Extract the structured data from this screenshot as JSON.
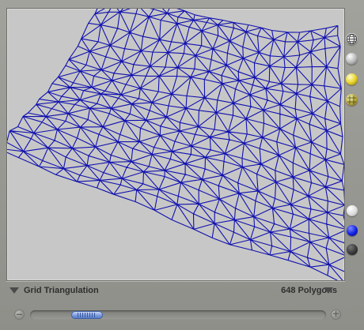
{
  "viewport": {
    "name": "wireframe-terrain",
    "wire_color": "#1010b0",
    "background_color": "#c7c7c7"
  },
  "render_mode_buttons": [
    "globe-icon",
    "silver-sphere-icon",
    "yellow-sphere-icon",
    "grid-sphere-icon"
  ],
  "color_swatches": [
    {
      "name": "white",
      "color": "#ffffff"
    },
    {
      "name": "blue",
      "color": "#1020e0"
    },
    {
      "name": "dark-gray",
      "color": "#3a3a3a"
    }
  ],
  "footer": {
    "mode_label": "Grid Triangulation",
    "polygon_label": "648 Polygons"
  },
  "slider": {
    "minus_glyph": "–",
    "plus_glyph": "+",
    "value_fraction": 0.15
  }
}
